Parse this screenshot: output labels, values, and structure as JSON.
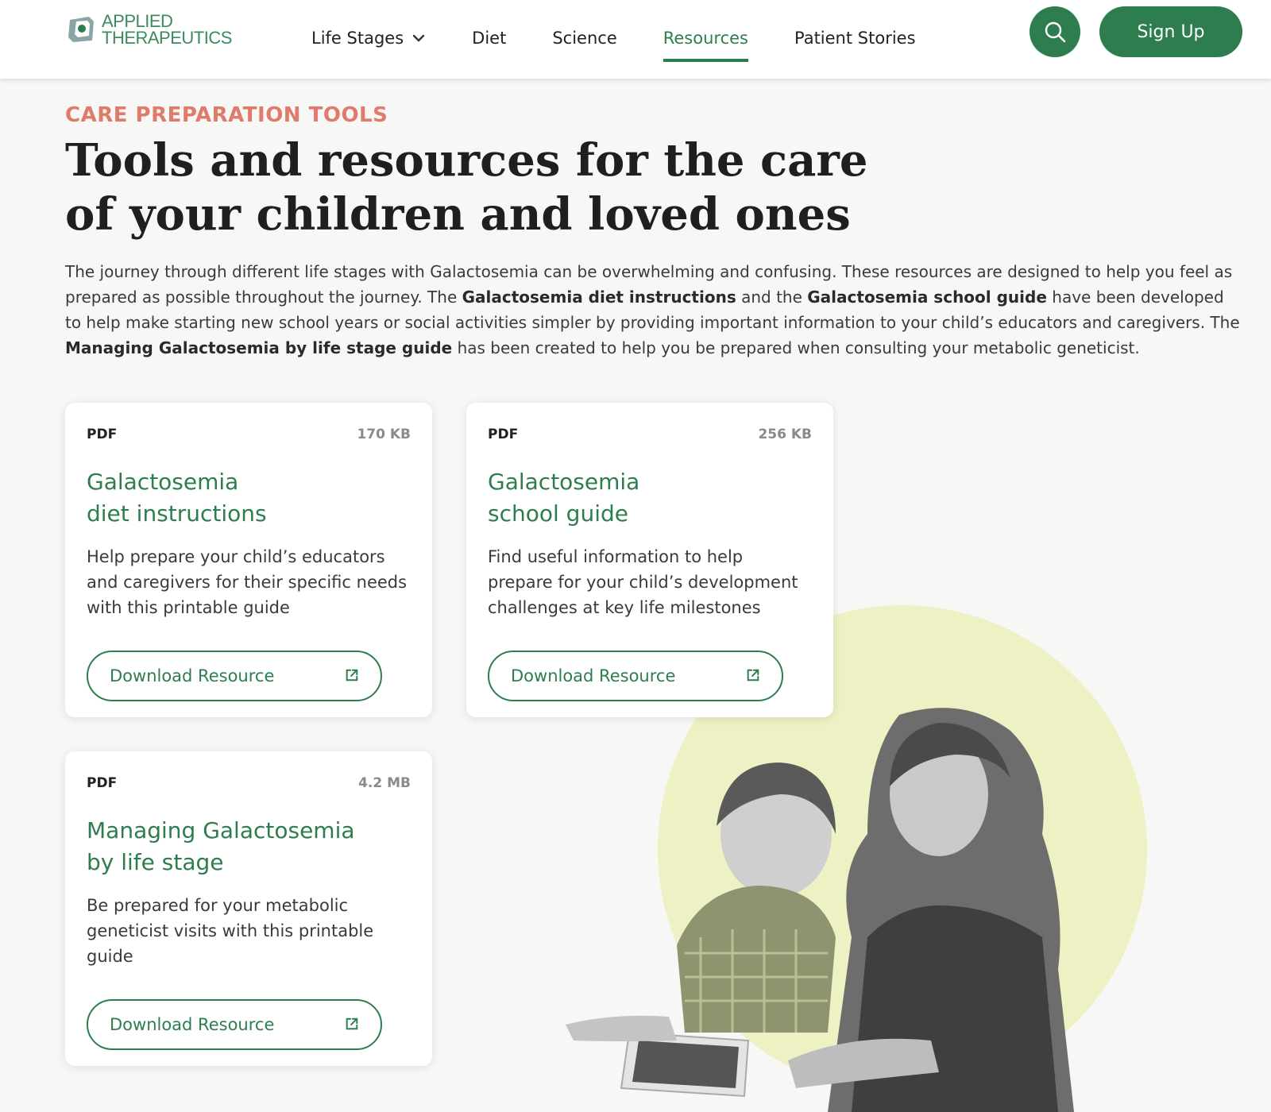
{
  "brand": {
    "line1": "APPLIED",
    "line2": "THERAPEUTICS",
    "logo_icon": "applied-therapeutics-logo"
  },
  "nav": {
    "items": [
      {
        "label": "Life Stages",
        "has_dropdown": true
      },
      {
        "label": "Diet"
      },
      {
        "label": "Science"
      },
      {
        "label": "Resources",
        "active": true
      },
      {
        "label": "Patient Stories"
      }
    ],
    "search_icon": "search-icon",
    "signup_label": "Sign Up"
  },
  "hero": {
    "eyebrow": "CARE PREPARATION TOOLS",
    "title": "Tools and resources for the care of your children and loved ones",
    "intro": {
      "p1": "The journey through different life stages with Galactosemia can be overwhelming and confusing. These resources are designed to help you feel as prepared as possible throughout the journey. The ",
      "b1": "Galactosemia diet instructions",
      "p2": " and the ",
      "b2": "Galactosemia school guide",
      "p3": " have been developed to help make starting new school years or social activities simpler by providing important information to your child’s educators and caregivers. The ",
      "b3": "Managing Galactosemia by life stage guide",
      "p4": " has been created to help you be prepared when consulting your metabolic geneticist."
    }
  },
  "cards": [
    {
      "type": "PDF",
      "size": "170 KB",
      "title": "Galactosemia\ndiet instructions",
      "description": "Help prepare your child’s educators and caregivers for their specific needs with this printable guide",
      "button": "Download Resource"
    },
    {
      "type": "PDF",
      "size": "256 KB",
      "title": "Galactosemia\nschool guide",
      "description": "Find useful information to help prepare for your child’s development challenges at key life milestones",
      "button": "Download Resource"
    },
    {
      "type": "PDF",
      "size": "4.2 MB",
      "title": "Managing Galactosemia\nby life stage",
      "description": "Be prepared for your metabolic geneticist visits with this printable guide",
      "button": "Download Resource"
    }
  ],
  "colors": {
    "brand_green": "#2e7d4f",
    "eyebrow_coral": "#e07a6a",
    "blob_yellow": "#eef1c3"
  }
}
